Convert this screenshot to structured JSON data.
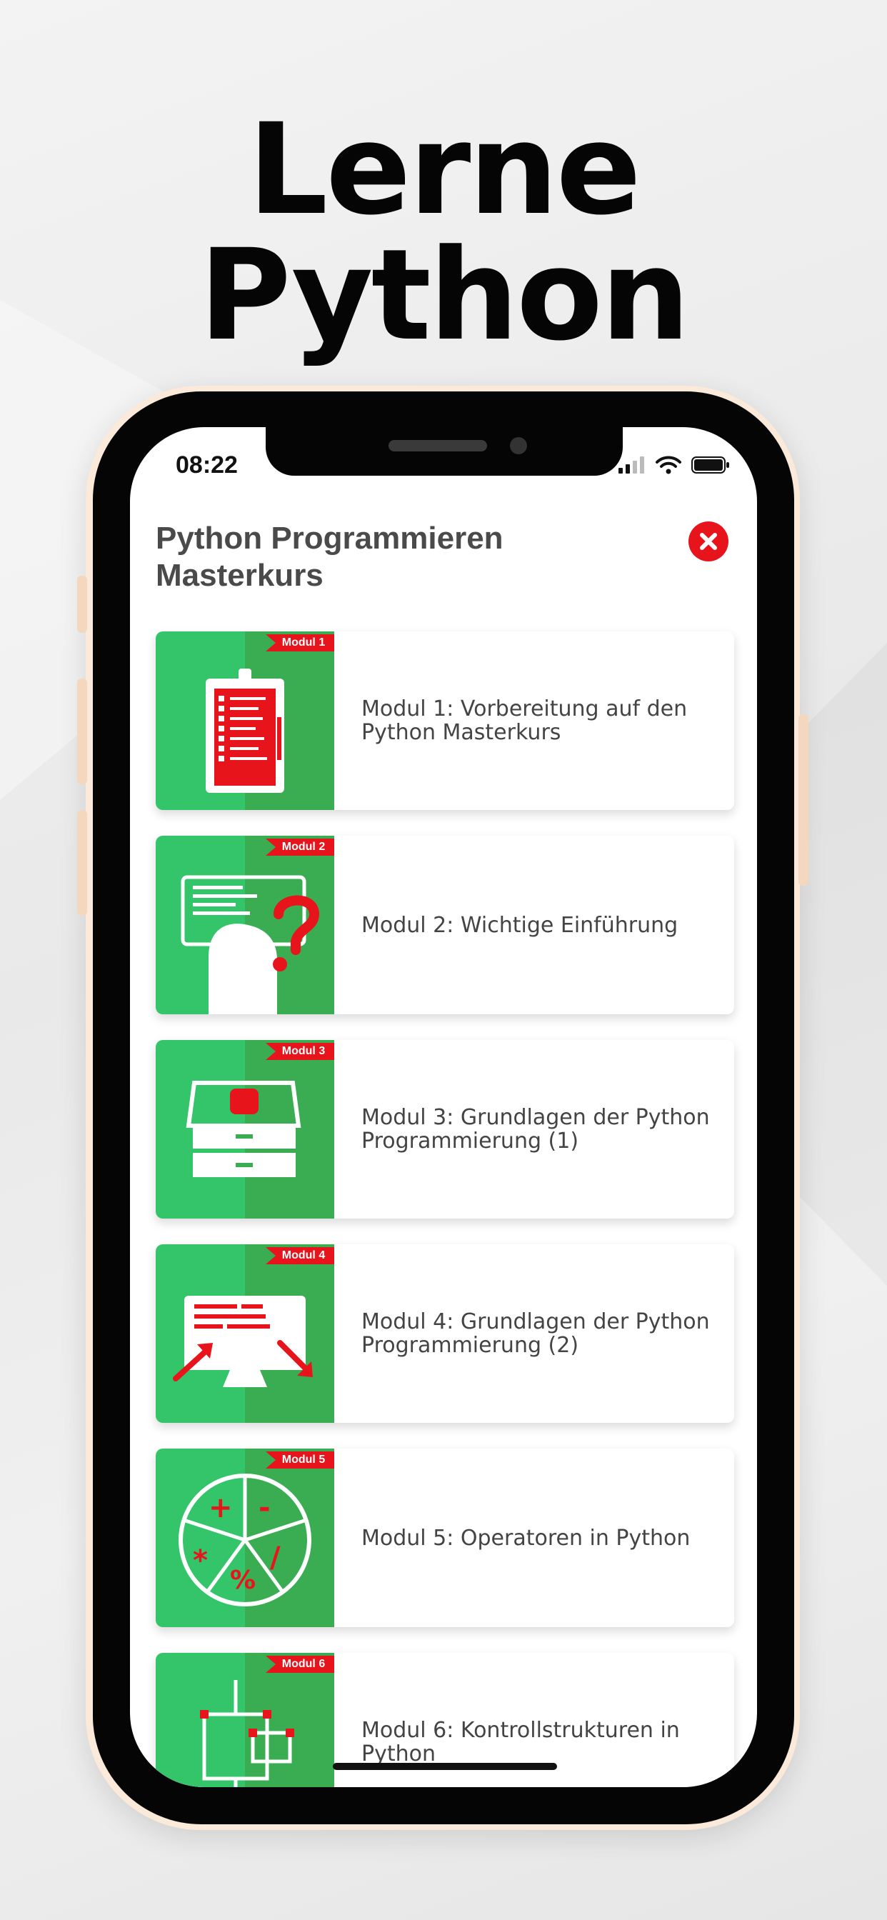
{
  "headline": "Lerne Python",
  "status_bar": {
    "time": "08:22"
  },
  "screen": {
    "title": "Python Programmieren Masterkurs",
    "close_icon": "close-circle-icon",
    "modules": [
      {
        "badge": "Modul 1",
        "label": "Modul 1: Vorbereitung auf den Python Masterkurs",
        "icon": "clipboard-checklist-icon"
      },
      {
        "badge": "Modul 2",
        "label": "Modul 2: Wichtige Einführung",
        "icon": "person-question-icon"
      },
      {
        "badge": "Modul 3",
        "label": "Modul 3: Grundlagen der Python Programmierung (1)",
        "icon": "inbox-tray-icon"
      },
      {
        "badge": "Modul 4",
        "label": "Modul 4: Grundlagen der Python Programmierung (2)",
        "icon": "monitor-arrows-icon"
      },
      {
        "badge": "Modul 5",
        "label": "Modul 5: Operatoren in Python",
        "icon": "operators-pie-icon"
      },
      {
        "badge": "Modul 6",
        "label": "Modul 6: Kontrollstrukturen in Python",
        "icon": "flowchart-icon"
      }
    ]
  },
  "colors": {
    "accent_red": "#e8141c",
    "green_light": "#34c46a",
    "green_dark": "#3aad53"
  }
}
